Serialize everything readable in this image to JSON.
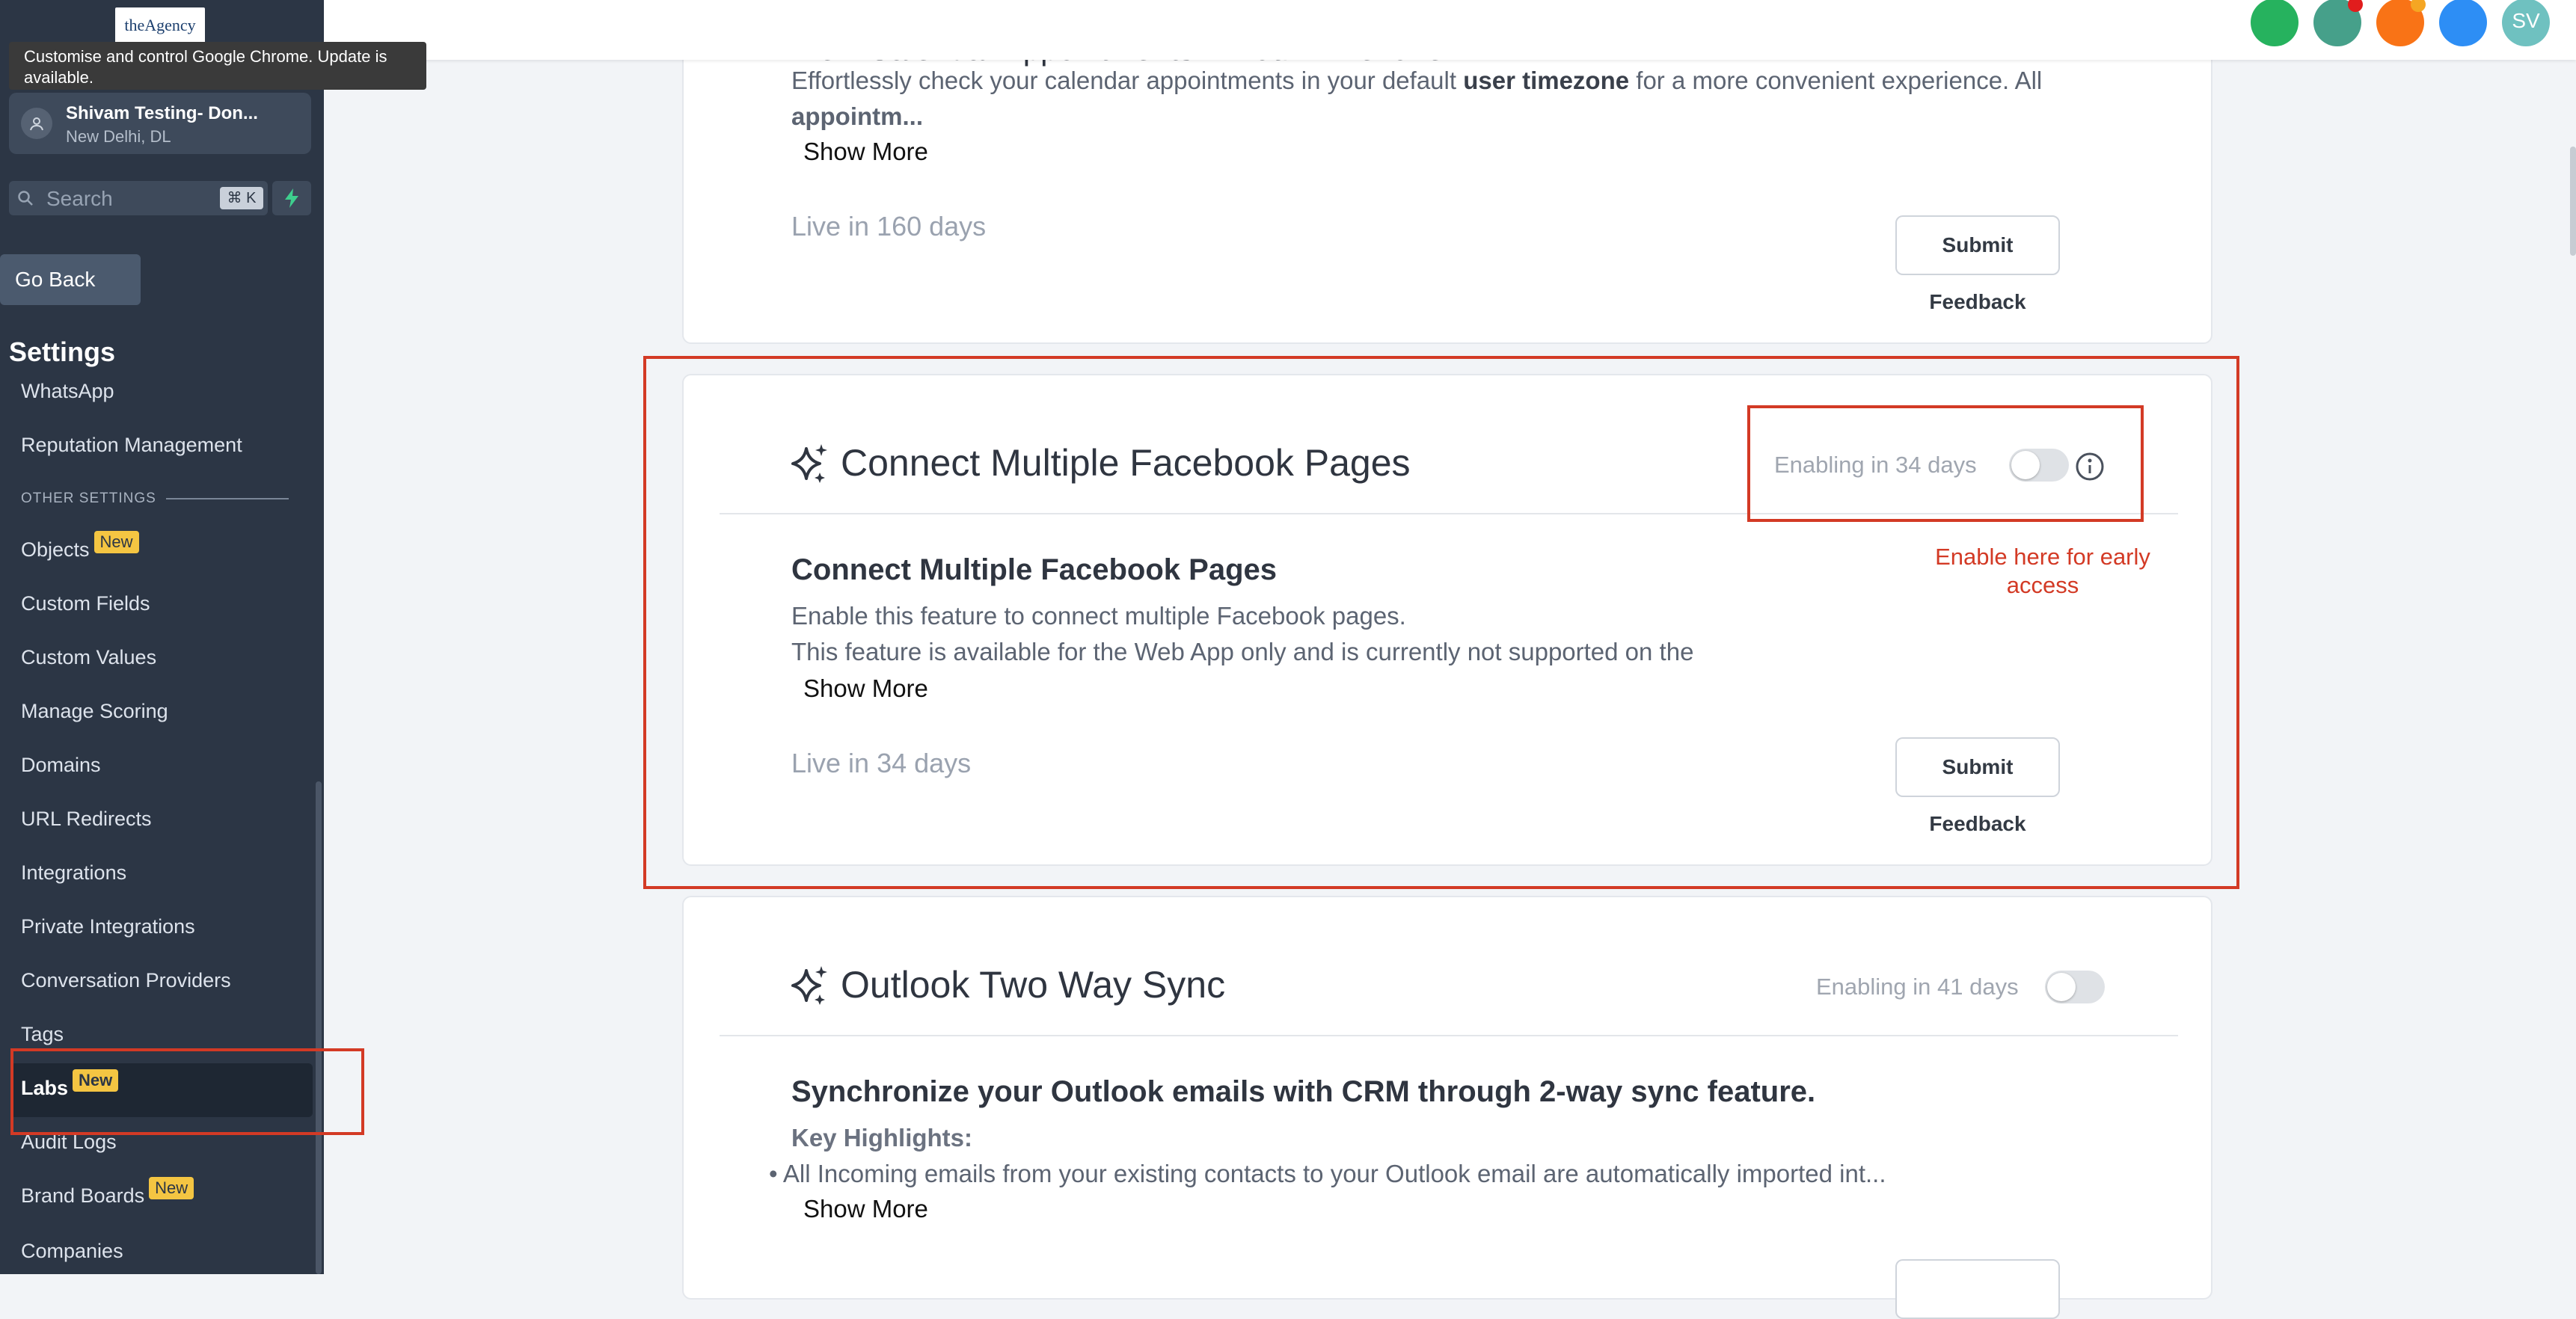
{
  "browser": {
    "tooltip": "Customise and control Google Chrome. Update is available."
  },
  "sidebar": {
    "logo_text": "theAgency",
    "account": {
      "name": "Shivam Testing- Don...",
      "location": "New Delhi, DL"
    },
    "search": {
      "placeholder": "Search",
      "shortcut": "⌘ K"
    },
    "go_back": "Go Back",
    "title": "Settings",
    "items": [
      {
        "label": "WhatsApp"
      },
      {
        "label": "Reputation Management"
      },
      {
        "label": "Objects",
        "badge": "New"
      },
      {
        "label": "Custom Fields"
      },
      {
        "label": "Custom Values"
      },
      {
        "label": "Manage Scoring"
      },
      {
        "label": "Domains"
      },
      {
        "label": "URL Redirects"
      },
      {
        "label": "Integrations"
      },
      {
        "label": "Private Integrations"
      },
      {
        "label": "Conversation Providers"
      },
      {
        "label": "Tags"
      },
      {
        "label": "Labs",
        "badge": "New",
        "active": true
      },
      {
        "label": "Audit Logs"
      },
      {
        "label": "Brand Boards",
        "badge": "New"
      },
      {
        "label": "Companies"
      }
    ],
    "section_label": "OTHER SETTINGS"
  },
  "topbar": {
    "avatar_initials": "SV",
    "colors": {
      "c1": "#26b25e",
      "c2": "#46a08a",
      "c3": "#f97316",
      "c4": "#2d8ef5",
      "c5": "#6fc1c0"
    }
  },
  "cards": {
    "calendar": {
      "title_partial": "View Calendar Appointments in Your Timezone",
      "desc_before": "Effortlessly check your calendar appointments in your default ",
      "desc_bold": "user timezone",
      "desc_after": " for a more convenient experience. All",
      "desc_line2": "appointm...",
      "show_more": "Show More",
      "live": "Live in 160 days",
      "feedback": "Submit Feedback"
    },
    "facebook": {
      "title": "Connect Multiple Facebook Pages",
      "enabling": "Enabling in 34 days",
      "subtitle": "Connect Multiple Facebook Pages",
      "desc1": "Enable this feature to connect multiple Facebook pages.",
      "desc2": "This feature is available for the Web App only and is currently not supported on the",
      "show_more": "Show More",
      "live": "Live in 34 days",
      "feedback": "Submit Feedback"
    },
    "outlook": {
      "title": "Outlook Two Way Sync",
      "enabling": "Enabling in 41 days",
      "subtitle": "Synchronize your Outlook emails with CRM through 2-way sync feature.",
      "highlights": "Key Highlights:",
      "bullet1": "All Incoming emails from your existing contacts to your Outlook email are automatically imported int...",
      "show_more": "Show More"
    }
  },
  "annotation": {
    "text": "Enable here for early access",
    "color": "#d33a25"
  }
}
